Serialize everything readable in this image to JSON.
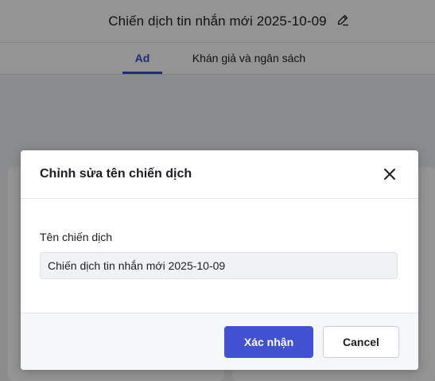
{
  "page": {
    "title": "Chiến dịch tin nhắn mới 2025-10-09",
    "tabs": [
      {
        "label": "Ad",
        "active": true
      },
      {
        "label": "Khán giả và ngân sách",
        "active": false
      }
    ]
  },
  "dialog": {
    "title": "Chỉnh sửa tên chiến dịch",
    "field_label": "Tên chiến dịch",
    "field_value": "Chiến dịch tin nhắn mới 2025-10-09",
    "confirm_label": "Xác nhận",
    "cancel_label": "Cancel"
  },
  "icons": {
    "edit": "pencil-icon",
    "close": "close-icon"
  },
  "colors": {
    "accent": "#4251d1",
    "active_tab": "#3b4bc8",
    "input_bg": "#f0f2f5"
  }
}
